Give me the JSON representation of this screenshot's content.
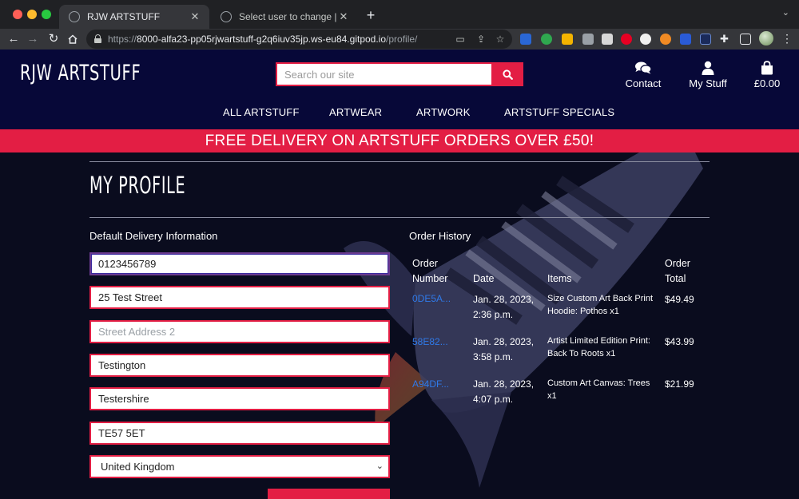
{
  "browser": {
    "tabs": [
      {
        "title": "RJW ARTSTUFF",
        "active": true
      },
      {
        "title": "Select user to change | Djang",
        "active": false
      }
    ],
    "url": {
      "prefix": "https://",
      "host": "8000-alfa23-pp05rjwartstuff-g2q6iuv35jp.ws-eu84.gitpod.io",
      "path": "/profile/"
    },
    "close_glyph": "✕",
    "new_tab_glyph": "+"
  },
  "header": {
    "logo": "RJW ARTSTUFF",
    "search_placeholder": "Search our site",
    "contact_label": "Contact",
    "account_label": "My Stuff",
    "cart_total": "£0.00"
  },
  "nav": {
    "items": [
      "ALL ARTSTUFF",
      "ARTWEAR",
      "ARTWORK",
      "ARTSTUFF SPECIALS"
    ]
  },
  "banner": {
    "text": "FREE DELIVERY ON ARTSTUFF ORDERS OVER £50!"
  },
  "profile": {
    "title": "MY PROFILE",
    "delivery_heading": "Default Delivery Information",
    "fields": {
      "phone": {
        "value": "0123456789",
        "placeholder": ""
      },
      "street1": {
        "value": "25 Test Street",
        "placeholder": ""
      },
      "street2": {
        "value": "",
        "placeholder": "Street Address 2"
      },
      "town": {
        "value": "Testington",
        "placeholder": ""
      },
      "county": {
        "value": "Testershire",
        "placeholder": ""
      },
      "postcode": {
        "value": "TE57 5ET",
        "placeholder": ""
      }
    },
    "country": "United Kingdom"
  },
  "orders": {
    "heading": "Order History",
    "columns": {
      "number": [
        "Order",
        "Number"
      ],
      "date": "Date",
      "items": "Items",
      "total": [
        "Order",
        "Total"
      ]
    },
    "rows": [
      {
        "number": "0DE5A...",
        "date": [
          "Jan. 28, 2023,",
          "2:36 p.m."
        ],
        "items": [
          "Size Custom Art Back Print",
          "Hoodie: Pothos x1"
        ],
        "total": "$49.49"
      },
      {
        "number": "58E82...",
        "date": [
          "Jan. 28, 2023,",
          "3:58 p.m."
        ],
        "items": [
          "Artist Limited Edition Print:",
          "Back To Roots x1"
        ],
        "total": "$43.99"
      },
      {
        "number": "A94DF...",
        "date": [
          "Jan. 28, 2023,",
          "4:07 p.m."
        ],
        "items": [
          "Custom Art Canvas: Trees",
          "x1"
        ],
        "total": "$21.99"
      }
    ]
  },
  "colors": {
    "navy": "#070838",
    "accent_red": "#e31e44",
    "link_blue": "#2f79e8"
  }
}
